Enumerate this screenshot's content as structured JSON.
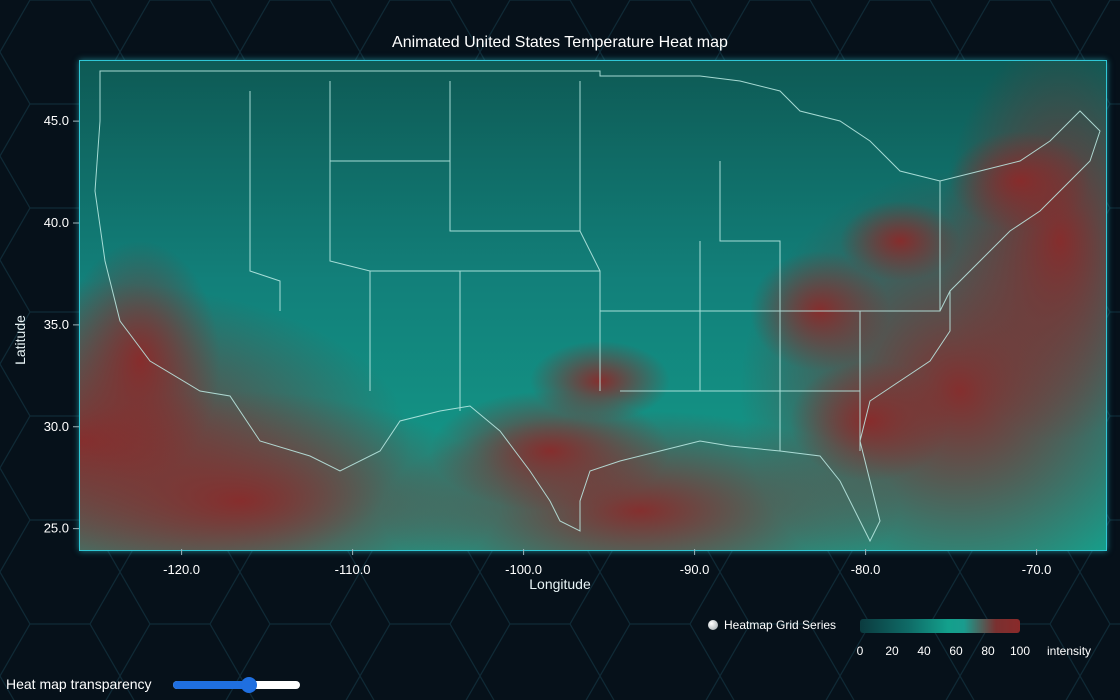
{
  "title": "Animated United States Temperature Heat map",
  "chart_data": {
    "type": "heatmap",
    "title": "Animated United States Temperature Heat map",
    "xlabel": "Longitude",
    "ylabel": "Latitude",
    "xlim": [
      -126.0,
      -66.0
    ],
    "ylim": [
      24.0,
      48.0
    ],
    "x_ticks": [
      -120.0,
      -110.0,
      -100.0,
      -90.0,
      -80.0,
      -70.0
    ],
    "x_tick_labels": [
      "-120.0",
      "-110.0",
      "-100.0",
      "-90.0",
      "-80.0",
      "-70.0"
    ],
    "y_ticks": [
      25.0,
      30.0,
      35.0,
      40.0,
      45.0
    ],
    "y_tick_labels": [
      "25.0",
      "30.0",
      "35.0",
      "40.0",
      "45.0"
    ],
    "series": [
      {
        "name": "Heatmap Grid Series"
      }
    ],
    "color_scale": {
      "min": 0,
      "max": 100,
      "ticks": [
        "0",
        "20",
        "40",
        "60",
        "80",
        "100"
      ],
      "label": "intensity",
      "colors": [
        "#0b3b3f",
        "#13a08c",
        "#8a2a2a"
      ]
    },
    "legend_position": "bottom-right",
    "grid": false
  },
  "legend": {
    "series_name": "Heatmap Grid Series",
    "ticks": [
      "0",
      "20",
      "40",
      "60",
      "80",
      "100"
    ],
    "unit_label": "intensity"
  },
  "controls": {
    "transparency_label": "Heat map transparency",
    "transparency_value": 0.6
  },
  "colors": {
    "background": "#06111a",
    "frame": "#2fc7d6",
    "cool": "#0f6a66",
    "mid": "#13a08c",
    "hot": "#8a2a2a",
    "slider": "#1f6fe0"
  }
}
